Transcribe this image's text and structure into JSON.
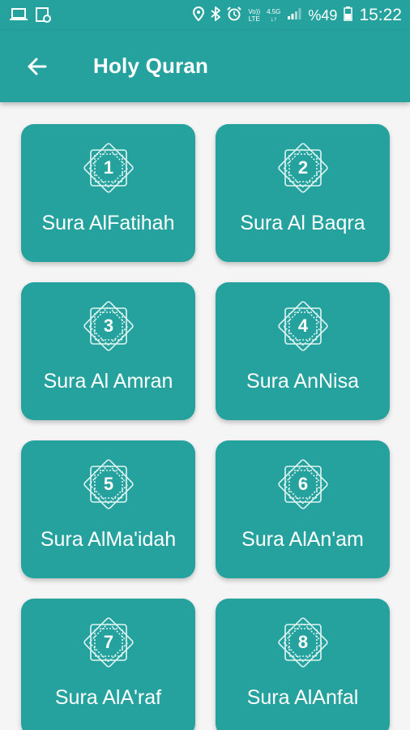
{
  "status_bar": {
    "network_top": "Vo))",
    "network_bottom": "LTE",
    "data_top": "4.5G",
    "battery": "%49",
    "time": "15:22",
    "icons": [
      "laptop-icon",
      "image-settings-icon",
      "location-icon",
      "bluetooth-icon",
      "alarm-icon",
      "signal-icon",
      "battery-icon"
    ]
  },
  "app_bar": {
    "title": "Holy Quran",
    "back_icon": "arrow-back-icon",
    "color": "#26a29e"
  },
  "suras": [
    {
      "number": "1",
      "label": "Sura AlFatihah"
    },
    {
      "number": "2",
      "label": "Sura Al Baqra"
    },
    {
      "number": "3",
      "label": "Sura Al Amran"
    },
    {
      "number": "4",
      "label": "Sura AnNisa"
    },
    {
      "number": "5",
      "label": "Sura AlMa'idah"
    },
    {
      "number": "6",
      "label": "Sura AlAn'am"
    },
    {
      "number": "7",
      "label": "Sura AlA'raf"
    },
    {
      "number": "8",
      "label": "Sura AlAnfal"
    }
  ]
}
